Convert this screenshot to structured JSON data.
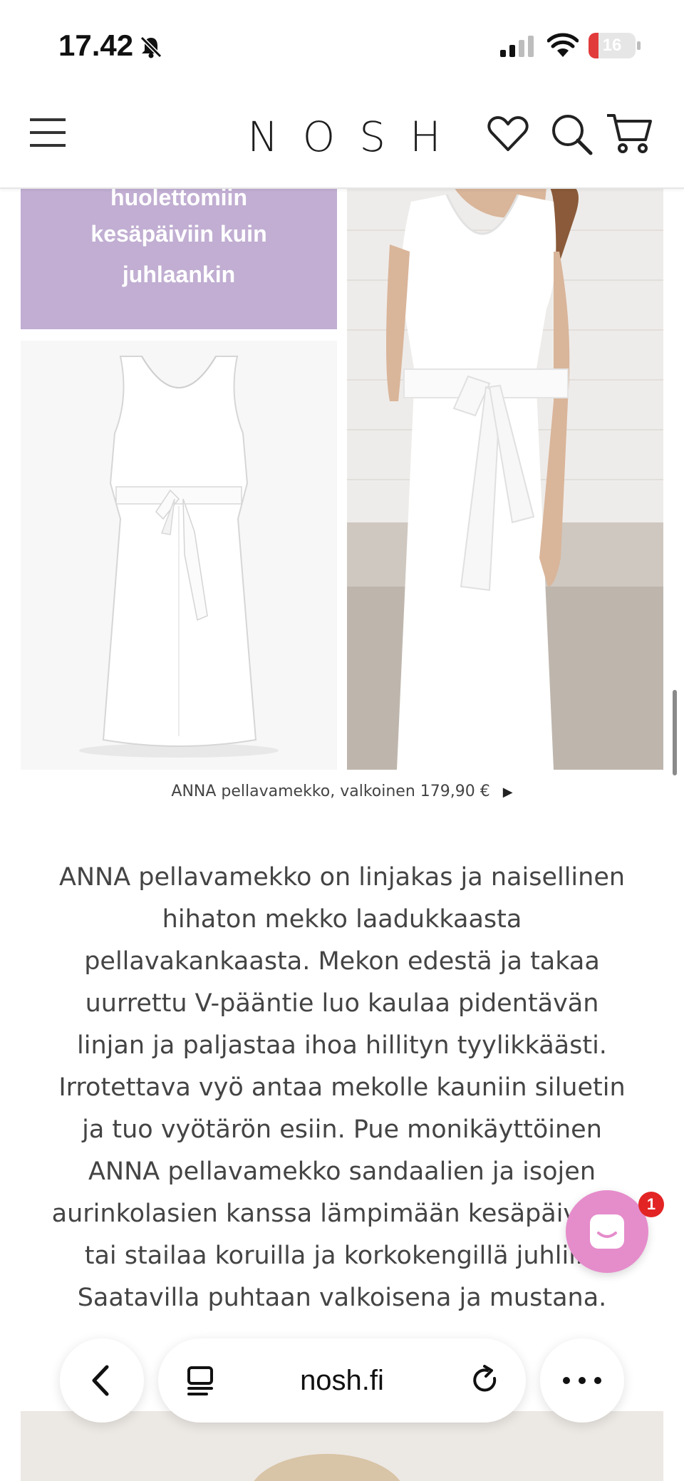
{
  "status_bar": {
    "time": "17.42",
    "battery": "16"
  },
  "header": {
    "logo": "NOSH"
  },
  "promo": {
    "lines": [
      "huolettomiin",
      "kesäpäiviin kuin",
      "juhlaankin"
    ]
  },
  "product": {
    "caption": "ANNA pellavamekko, valkoinen 179,90 €"
  },
  "description": {
    "lines": [
      "ANNA pellavamekko on linjakas ja naisellinen",
      "hihaton mekko laadukkaasta",
      "pellavakankaasta. Mekon edestä ja takaa",
      "uurrettu V-pääntie luo kaulaa pidentävän",
      "linjan ja paljastaa ihoa hillityn tyylikkäästi.",
      "Irrotettava vyö antaa mekolle kauniin siluetin",
      "ja tuo vyötärön esiin. Pue monikäyttöinen",
      "ANNA pellavamekko sandaalien ja isojen",
      "aurinkolasien kanssa lämpimään kesäpäivään,",
      "tai stailaa koruilla ja korkokengillä juhliin.",
      "Saatavilla puhtaan valkoisena ja mustana."
    ]
  },
  "chat": {
    "badge_count": "1"
  },
  "browser": {
    "url": "nosh.fi"
  },
  "colors": {
    "promo_bg": "#c1aed2",
    "chat_bg": "#e58ccb",
    "badge_bg": "#e32424"
  }
}
